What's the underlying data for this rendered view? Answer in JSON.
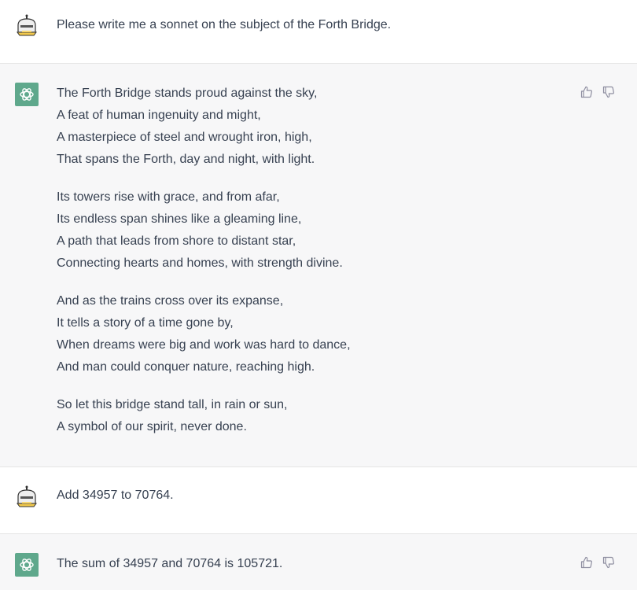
{
  "conversation": {
    "turn1": {
      "role": "user",
      "avatar_icon": "robot-avatar-icon",
      "text": "Please write me a sonnet on the subject of the Forth Bridge."
    },
    "turn2": {
      "role": "assistant",
      "avatar_icon": "openai-logo-icon",
      "stanzas": [
        [
          "The Forth Bridge stands proud against the sky,",
          "A feat of human ingenuity and might,",
          "A masterpiece of steel and wrought iron, high,",
          "That spans the Forth, day and night, with light."
        ],
        [
          "Its towers rise with grace, and from afar,",
          "Its endless span shines like a gleaming line,",
          "A path that leads from shore to distant star,",
          "Connecting hearts and homes, with strength divine."
        ],
        [
          "And as the trains cross over its expanse,",
          "It tells a story of a time gone by,",
          "When dreams were big and work was hard to dance,",
          "And man could conquer nature, reaching high."
        ],
        [
          "So let this bridge stand tall, in rain or sun,",
          "A symbol of our spirit, never done."
        ]
      ],
      "feedback": [
        "thumbs-up-icon",
        "thumbs-down-icon"
      ]
    },
    "turn3": {
      "role": "user",
      "avatar_icon": "robot-avatar-icon",
      "text": "Add 34957 to 70764."
    },
    "turn4": {
      "role": "assistant",
      "avatar_icon": "openai-logo-icon",
      "text": "The sum of 34957 and 70764 is 105721.",
      "feedback": [
        "thumbs-up-icon",
        "thumbs-down-icon"
      ]
    }
  },
  "colors": {
    "user_bg": "#ffffff",
    "assistant_bg": "#f7f7f8",
    "assistant_avatar": "#5fa88c",
    "text": "#374151",
    "icon": "#8e8ea0"
  }
}
